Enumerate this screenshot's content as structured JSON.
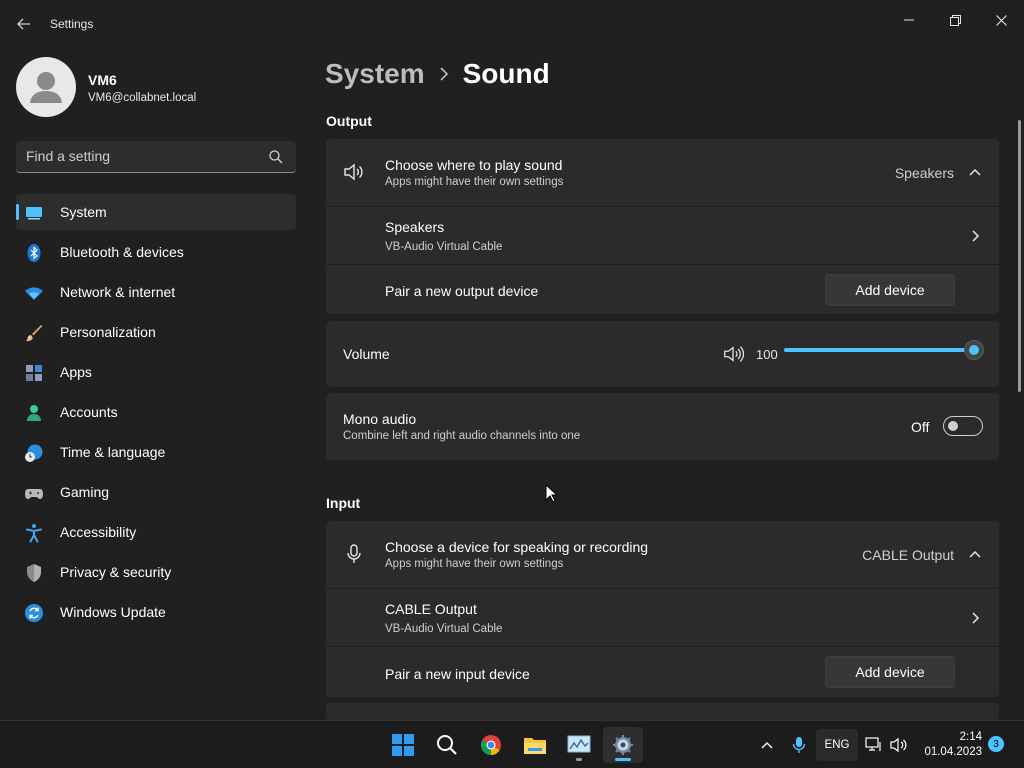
{
  "window": {
    "title": "Settings"
  },
  "user": {
    "name": "VM6",
    "email": "VM6@collabnet.local"
  },
  "search": {
    "placeholder": "Find a setting"
  },
  "sidebar": {
    "items": [
      {
        "label": "System",
        "icon": "system-icon",
        "active": true
      },
      {
        "label": "Bluetooth & devices",
        "icon": "bluetooth-icon"
      },
      {
        "label": "Network & internet",
        "icon": "wifi-icon"
      },
      {
        "label": "Personalization",
        "icon": "brush-icon"
      },
      {
        "label": "Apps",
        "icon": "apps-icon"
      },
      {
        "label": "Accounts",
        "icon": "person-icon"
      },
      {
        "label": "Time & language",
        "icon": "globe-clock-icon"
      },
      {
        "label": "Gaming",
        "icon": "gamepad-icon"
      },
      {
        "label": "Accessibility",
        "icon": "accessibility-icon"
      },
      {
        "label": "Privacy & security",
        "icon": "shield-icon"
      },
      {
        "label": "Windows Update",
        "icon": "update-icon"
      }
    ]
  },
  "breadcrumb": {
    "parent": "System",
    "current": "Sound"
  },
  "output": {
    "section_title": "Output",
    "choose_title": "Choose where to play sound",
    "choose_subtitle": "Apps might have their own settings",
    "choose_value": "Speakers",
    "device_name": "Speakers",
    "device_sub": "VB-Audio Virtual Cable",
    "pair_label": "Pair a new output device",
    "add_button": "Add device"
  },
  "volume": {
    "label": "Volume",
    "value": "100",
    "level": 1.0
  },
  "mono": {
    "title": "Mono audio",
    "subtitle": "Combine left and right audio channels into one",
    "state": "Off"
  },
  "input": {
    "section_title": "Input",
    "choose_title": "Choose a device for speaking or recording",
    "choose_subtitle": "Apps might have their own settings",
    "choose_value": "CABLE Output",
    "device_name": "CABLE Output",
    "device_sub": "VB-Audio Virtual Cable",
    "pair_label": "Pair a new input device",
    "add_button": "Add device"
  },
  "taskbar": {
    "language": "ENG",
    "time": "2:14",
    "date": "01.04.2023",
    "notifications": "3"
  },
  "colors": {
    "accent": "#4cc2ff",
    "background": "#202020",
    "card": "#2b2b2b"
  }
}
